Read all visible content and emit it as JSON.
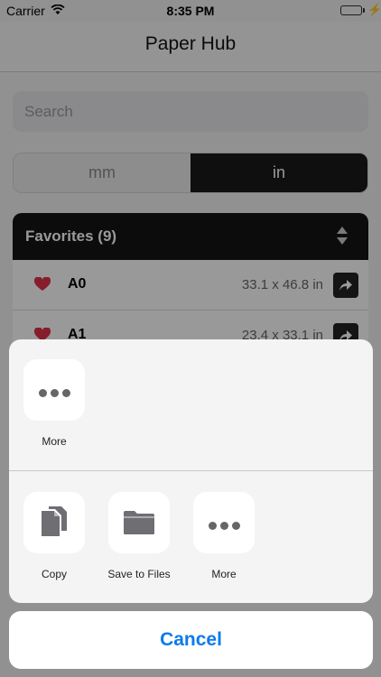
{
  "status_bar": {
    "carrier": "Carrier",
    "time": "8:35 PM"
  },
  "nav": {
    "title": "Paper Hub"
  },
  "search": {
    "placeholder": "Search"
  },
  "units": {
    "options": [
      "mm",
      "in"
    ],
    "selected": "in"
  },
  "favorites": {
    "title": "Favorites (9)",
    "rows": [
      {
        "name": "A0",
        "dims": "33.1 x 46.8 in"
      },
      {
        "name": "A1",
        "dims": "23.4 x 33.1 in"
      }
    ]
  },
  "share_sheet": {
    "top_row": [
      {
        "label": "More",
        "icon": "more-dots-icon"
      }
    ],
    "actions": [
      {
        "label": "Copy",
        "icon": "copy-icon"
      },
      {
        "label": "Save to Files",
        "icon": "folder-icon"
      },
      {
        "label": "More",
        "icon": "more-dots-icon"
      }
    ],
    "cancel_label": "Cancel"
  },
  "colors": {
    "accent": "#0b7bea",
    "heart": "#e0314b",
    "dark": "#141414"
  }
}
